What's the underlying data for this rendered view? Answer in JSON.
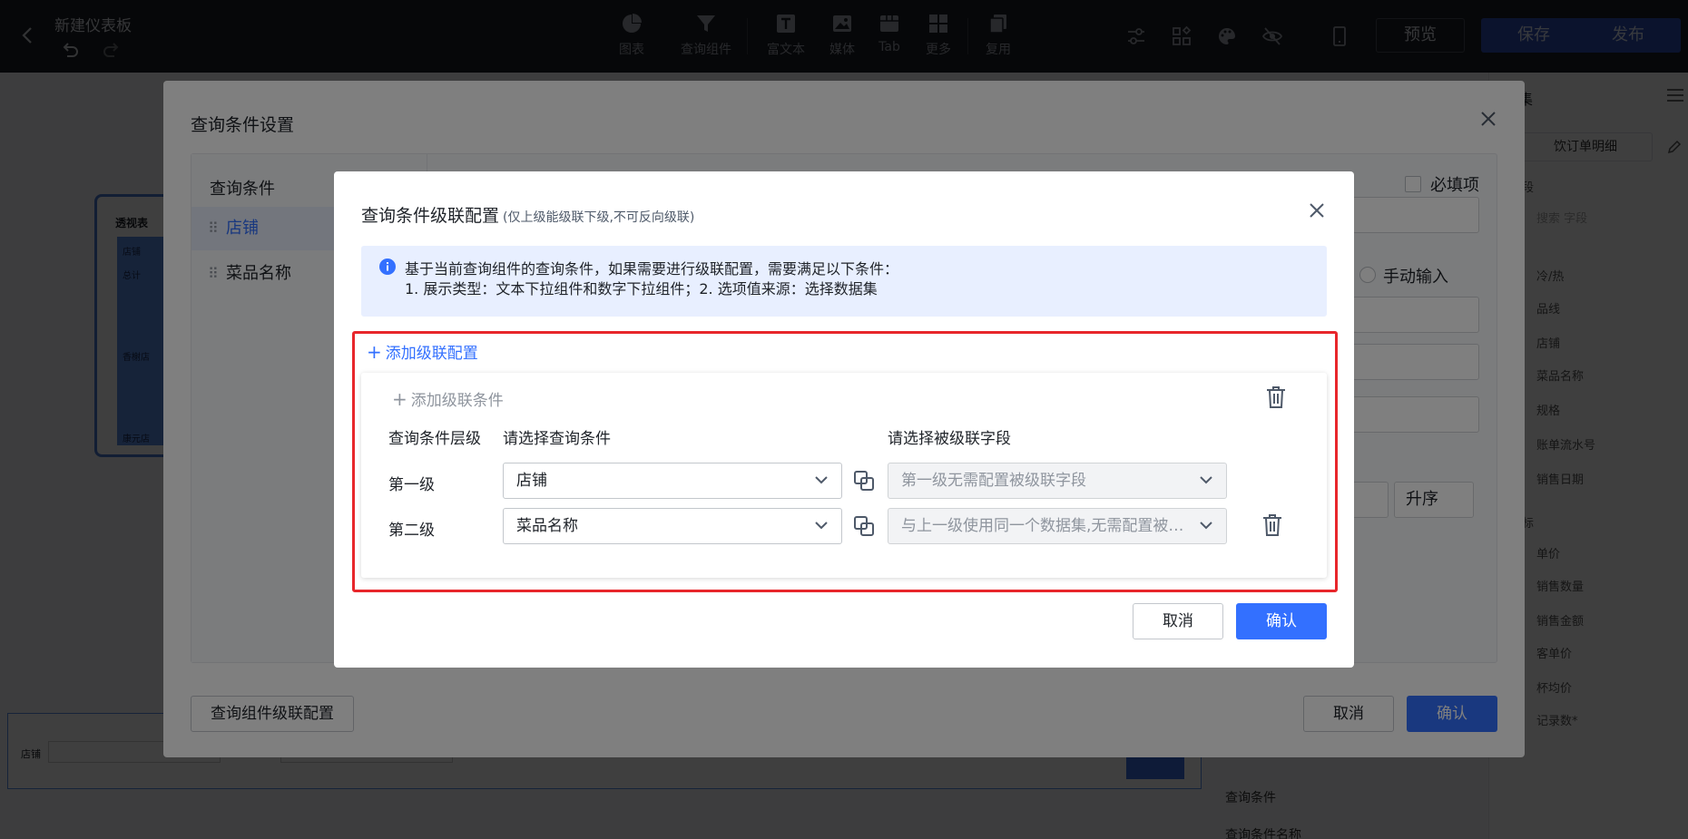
{
  "topbar": {
    "title": "新建仪表板",
    "tools": [
      {
        "label": "图表",
        "icon": "pie-chart-icon"
      },
      {
        "label": "查询组件",
        "icon": "filter-icon"
      },
      {
        "label": "富文本",
        "icon": "text-icon"
      },
      {
        "label": "媒体",
        "icon": "image-icon"
      },
      {
        "label": "Tab",
        "icon": "tab-icon"
      },
      {
        "label": "更多",
        "icon": "grid-icon"
      },
      {
        "label": "复用",
        "icon": "copy-icon"
      }
    ],
    "preview": "预览",
    "save": "保存",
    "publish": "发布"
  },
  "right_panel": {
    "title_fragment": "集",
    "dataset": "饮订单明细",
    "dim_label": "段",
    "search_placeholder": "搜索 字段",
    "fields": [
      "冷/热",
      "品线",
      "店铺",
      "菜品名称",
      "规格",
      "账单流水号",
      "销售日期"
    ],
    "measure_label": "标",
    "measures": [
      "单价",
      "销售数量",
      "销售金额",
      "客单价",
      "杯均价",
      "记录数*"
    ],
    "bottom_items": [
      "查询条件",
      "查询条件名称"
    ]
  },
  "canvas": {
    "pivot_title": "透视表",
    "pivot_rows": [
      "店铺",
      "总计",
      "香榭店",
      "康元店"
    ],
    "widget_label": "店铺"
  },
  "outer_dialog": {
    "title": "查询条件设置",
    "list_header": "查询条件",
    "items": [
      "店铺",
      "菜品名称"
    ],
    "required_label": "必填项",
    "manual_input_label": "手动输入",
    "sort_label": "升序",
    "cascade_button": "查询组件级联配置",
    "cancel": "取消",
    "confirm": "确认"
  },
  "inner_dialog": {
    "title": "查询条件级联配置",
    "subtitle": "(仅上级能级联下级,不可反向级联)",
    "notice_line1": "基于当前查询组件的查询条件，如果需要进行级联配置，需要满足以下条件：",
    "notice_line2": "1. 展示类型：文本下拉组件和数字下拉组件；2. 选项值来源：选择数据集",
    "add_cascade": "添加级联配置",
    "add_condition": "添加级联条件",
    "headers": {
      "level": "查询条件层级",
      "condition": "请选择查询条件",
      "field": "请选择被级联字段"
    },
    "rows": [
      {
        "level": "第一级",
        "condition": "店铺",
        "field": "第一级无需配置被级联字段"
      },
      {
        "level": "第二级",
        "condition": "菜品名称",
        "field": "与上一级使用同一个数据集,无需配置被级联字段"
      }
    ],
    "cancel": "取消",
    "confirm": "确认"
  },
  "colors": {
    "accent": "#3370ff",
    "highlight": "#e8262b",
    "topbar_bg": "#1b1d24"
  }
}
